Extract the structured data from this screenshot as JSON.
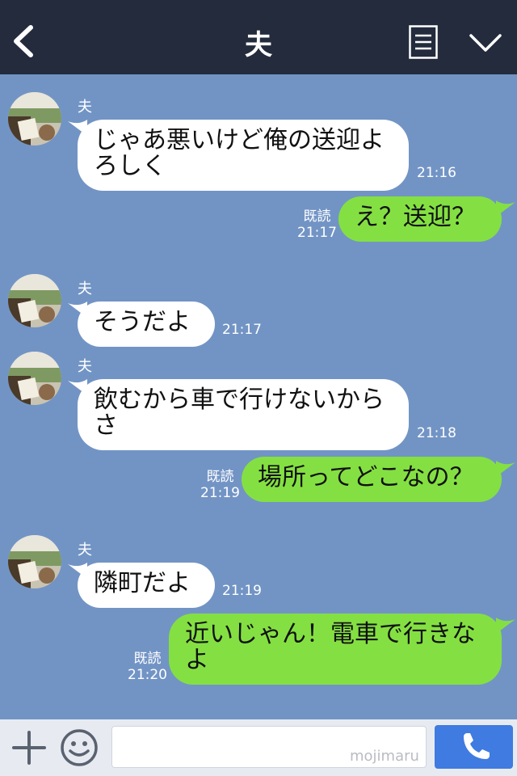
{
  "header": {
    "title": "夫"
  },
  "messages": [
    {
      "sender": "夫",
      "text": "じゃあ悪いけど俺の送迎よ\nろしく",
      "time": "21:16"
    },
    {
      "text": "え？送迎？",
      "read": "既読",
      "time": "21:17"
    },
    {
      "sender": "夫",
      "text": "そうだよ",
      "time": "21:17"
    },
    {
      "sender": "夫",
      "text": "飲むから車で行けないから\nさ",
      "time": "21:18"
    },
    {
      "text": "場所ってどこなの？",
      "read": "既読",
      "time": "21:19"
    },
    {
      "sender": "夫",
      "text": "隣町だよ",
      "time": "21:19"
    },
    {
      "text": "近いじゃん！電車で行きな\nよ",
      "read": "既読",
      "time": "21:20"
    }
  ],
  "footer": {
    "input_value": "",
    "watermark": "mojimaru"
  },
  "colors": {
    "header_bg": "#232b3d",
    "chat_bg": "#7294c5",
    "outgoing_bubble": "#84e042",
    "incoming_bubble": "#ffffff",
    "call_button": "#3f7be0"
  },
  "icons": [
    "back-icon",
    "menu-icon",
    "chevron-down-icon",
    "plus-icon",
    "emoji-icon",
    "phone-icon"
  ]
}
